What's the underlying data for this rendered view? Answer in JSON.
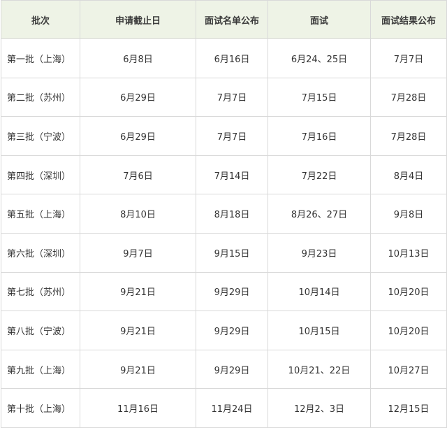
{
  "table": {
    "headers": [
      "批次",
      "申请截止日",
      "面试名单公布",
      "面试",
      "面试结果公布"
    ],
    "rows": [
      [
        "第一批（上海）",
        "6月8日",
        "6月16日",
        "6月24、25日",
        "7月7日"
      ],
      [
        "第二批（苏州）",
        "6月29日",
        "7月7日",
        "7月15日",
        "7月28日"
      ],
      [
        "第三批（宁波）",
        "6月29日",
        "7月7日",
        "7月16日",
        "7月28日"
      ],
      [
        "第四批（深圳）",
        "7月6日",
        "7月14日",
        "7月22日",
        "8月4日"
      ],
      [
        "第五批（上海）",
        "8月10日",
        "8月18日",
        "8月26、27日",
        "9月8日"
      ],
      [
        "第六批（深圳）",
        "9月7日",
        "9月15日",
        "9月23日",
        "10月13日"
      ],
      [
        "第七批（苏州）",
        "9月21日",
        "9月29日",
        "10月14日",
        "10月20日"
      ],
      [
        "第八批（宁波）",
        "9月21日",
        "9月29日",
        "10月15日",
        "10月20日"
      ],
      [
        "第九批（上海）",
        "9月21日",
        "9月29日",
        "10月21、22日",
        "10月27日"
      ],
      [
        "第十批（上海）",
        "11月16日",
        "11月24日",
        "12月2、3日",
        "12月15日"
      ]
    ]
  }
}
